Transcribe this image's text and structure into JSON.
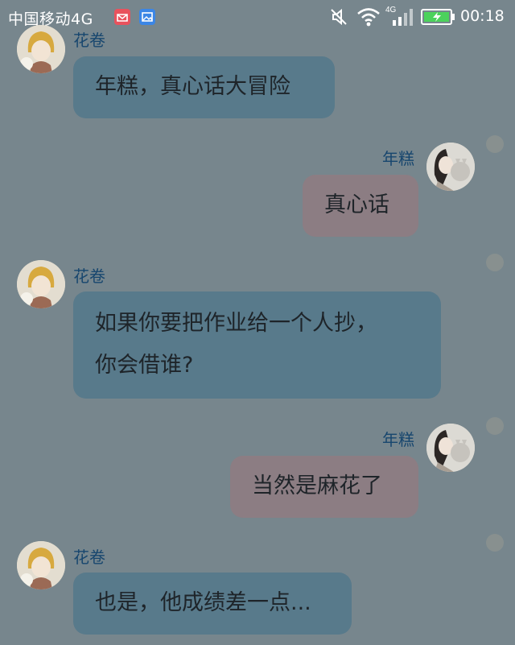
{
  "status_bar": {
    "carrier": "中国移动4G",
    "network_badge": "4G",
    "time": "00:18",
    "icons": [
      "mail-app-icon",
      "gallery-app-icon",
      "mute-icon",
      "wifi-icon",
      "signal-icon",
      "battery-charging-icon"
    ]
  },
  "chat": {
    "messages": [
      {
        "sender": "花卷",
        "side": "left",
        "lines": [
          "年糕，真心话大冒险"
        ]
      },
      {
        "sender": "年糕",
        "side": "right",
        "lines": [
          "真心话"
        ]
      },
      {
        "sender": "花卷",
        "side": "left",
        "lines": [
          "如果你要把作业给一个人抄，",
          "你会借谁?"
        ]
      },
      {
        "sender": "年糕",
        "side": "right",
        "lines": [
          "当然是麻花了"
        ]
      },
      {
        "sender": "花卷",
        "side": "left",
        "lines": [
          "也是，他成绩差一点..."
        ]
      }
    ]
  },
  "colors": {
    "background": "#77868d",
    "left_bubble": "#587a8b",
    "right_bubble": "#8c7d83",
    "sender_name": "#17466e"
  }
}
